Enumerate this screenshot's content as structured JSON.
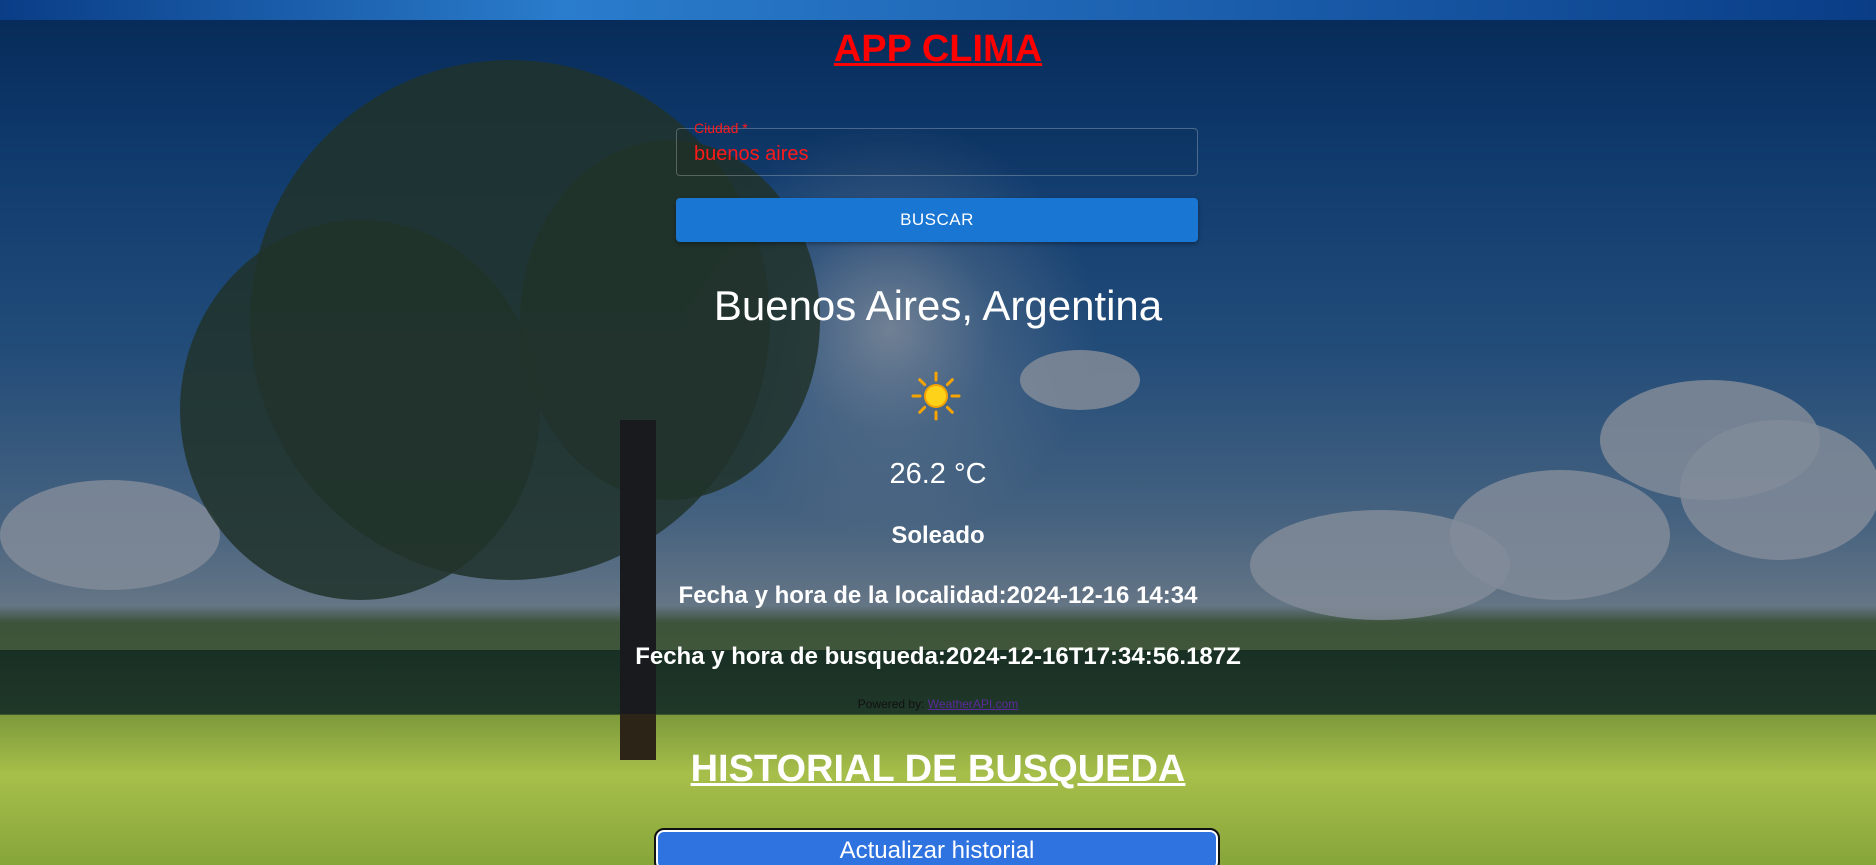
{
  "header": {
    "title": "APP CLIMA"
  },
  "search": {
    "label": "Ciudad *",
    "value": "buenos aires",
    "button_label": "BUSCAR"
  },
  "weather": {
    "location": "Buenos Aires, Argentina",
    "icon": "sun-icon",
    "temperature": "26.2 °C",
    "condition": "Soleado",
    "local_time": "Fecha y hora de la localidad:2024-12-16 14:34",
    "search_time": "Fecha y hora de busqueda:2024-12-16T17:34:56.187Z"
  },
  "footer": {
    "powered_prefix": "Powered by: ",
    "powered_link": "WeatherAPI.com"
  },
  "history": {
    "title": "HISTORIAL DE BUSQUEDA",
    "update_button_label": "Actualizar historial"
  },
  "colors": {
    "title": "#ff0000",
    "primary_button": "#1976d2",
    "update_button": "#2f73e0",
    "text": "#ffffff"
  }
}
